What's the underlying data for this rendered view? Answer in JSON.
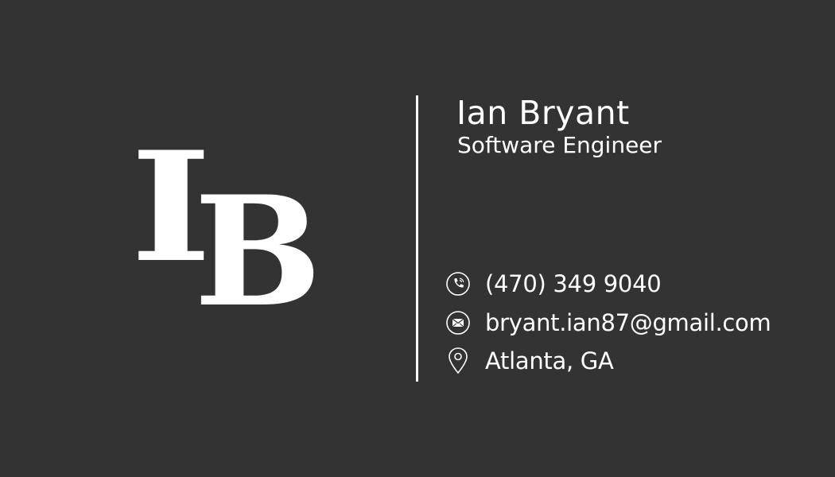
{
  "monogram": {
    "letter1": "I",
    "letter2": "B"
  },
  "person": {
    "name": "Ian Bryant",
    "title": "Software Engineer"
  },
  "contacts": [
    {
      "icon": "phone-icon",
      "text": "(470) 349 9040"
    },
    {
      "icon": "mail-icon",
      "text": "bryant.ian87@gmail.com"
    },
    {
      "icon": "location-pin-icon",
      "text": "Atlanta, GA"
    }
  ],
  "colors": {
    "background": "#333333",
    "foreground": "#ffffff"
  }
}
